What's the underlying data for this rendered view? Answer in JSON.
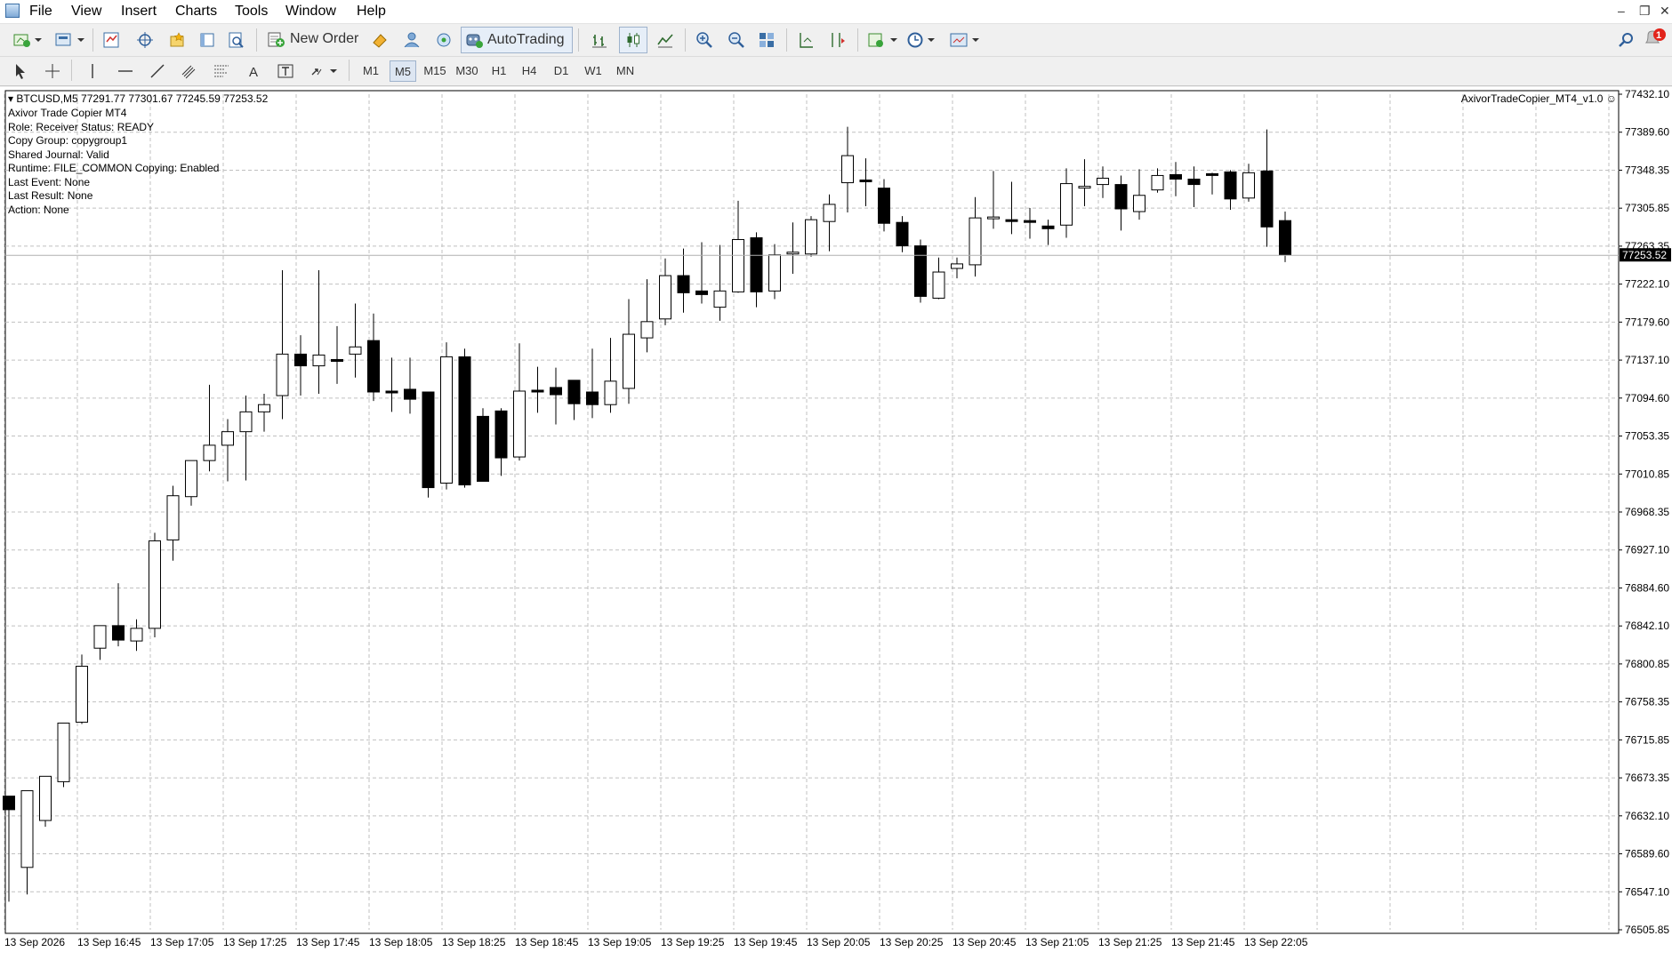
{
  "menu": [
    "File",
    "View",
    "Insert",
    "Charts",
    "Tools",
    "Window",
    "Help"
  ],
  "toolbar": {
    "new_order_label": "New Order",
    "autotrading_label": "AutoTrading",
    "notification_count": "1"
  },
  "timeframes": [
    "M1",
    "M5",
    "M15",
    "M30",
    "H1",
    "H4",
    "D1",
    "W1",
    "MN"
  ],
  "active_timeframe": "M5",
  "chart": {
    "header": "BTCUSD,M5  77291.77 77301.67 77245.59 77253.52",
    "ea_name": "AxivorTradeCopier_MT4_v1.0",
    "current_price_label": "77253.52",
    "info_lines": [
      "Axivor Trade Copier MT4",
      "Role: Receiver   Status: READY",
      "Copy Group: copygroup1",
      "Shared Journal: Valid",
      "Runtime: FILE_COMMON   Copying: Enabled",
      "Last Event: None",
      "Last Result: None",
      "Action: None"
    ]
  },
  "chart_data": {
    "type": "candlestick",
    "symbol": "BTCUSD",
    "timeframe": "M5",
    "ylim": [
      76505.85,
      77432.1
    ],
    "y_ticks": [
      "77432.10",
      "77389.60",
      "77348.35",
      "77305.85",
      "77263.35",
      "77222.10",
      "77179.60",
      "77137.10",
      "77094.60",
      "77053.35",
      "77010.85",
      "76968.35",
      "76927.10",
      "76884.60",
      "76842.10",
      "76800.85",
      "76758.35",
      "76715.85",
      "76673.35",
      "76632.10",
      "76589.60",
      "76547.10",
      "76505.85"
    ],
    "x_ticks": [
      "13 Sep 2026",
      "13 Sep 16:45",
      "13 Sep 17:05",
      "13 Sep 17:25",
      "13 Sep 17:45",
      "13 Sep 18:05",
      "13 Sep 18:25",
      "13 Sep 18:45",
      "13 Sep 19:05",
      "13 Sep 19:25",
      "13 Sep 19:45",
      "13 Sep 20:05",
      "13 Sep 20:25",
      "13 Sep 20:45",
      "13 Sep 21:05",
      "13 Sep 21:25",
      "13 Sep 21:45",
      "13 Sep 22:05"
    ],
    "current_price": 77253.52,
    "grid": true,
    "candles": [
      [
        76654,
        76639,
        76537,
        76654
      ],
      [
        76575,
        76660,
        76545,
        76575
      ],
      [
        76627,
        76676,
        76620,
        76658
      ],
      [
        76670,
        76735,
        76664,
        76733
      ],
      [
        76736,
        76798,
        76734,
        76811
      ],
      [
        76818,
        76843,
        76805,
        76836
      ],
      [
        76843,
        76827,
        76820,
        76890
      ],
      [
        76826,
        76840,
        76815,
        76850
      ],
      [
        76840,
        76937,
        76830,
        76946
      ],
      [
        76938,
        76987,
        76915,
        76998
      ],
      [
        76986,
        77026,
        76976,
        77026
      ],
      [
        77026,
        77043,
        77014,
        77110
      ],
      [
        77043,
        77058,
        77003,
        77072
      ],
      [
        77058,
        77080,
        77004,
        77098
      ],
      [
        77080,
        77088,
        77058,
        77100
      ],
      [
        77098,
        77144,
        77072,
        77237
      ],
      [
        77144,
        77131,
        77098,
        77165
      ],
      [
        77131,
        77143,
        77100,
        77237
      ],
      [
        77138,
        77136,
        77111,
        77175
      ],
      [
        77144,
        77152,
        77118,
        77200
      ],
      [
        77159,
        77102,
        77092,
        77189
      ],
      [
        77103,
        77101,
        77080,
        77140
      ],
      [
        77105,
        77094,
        77078,
        77140
      ],
      [
        77102,
        76996,
        76985,
        77102
      ],
      [
        77001,
        77141,
        76994,
        77157
      ],
      [
        77141,
        76999,
        76996,
        77150
      ],
      [
        77075,
        77003,
        77009,
        77084
      ],
      [
        77081,
        77029,
        77009,
        77084
      ],
      [
        77030,
        77103,
        77026,
        77156
      ],
      [
        77104,
        77102,
        77079,
        77130
      ],
      [
        77107,
        77099,
        77066,
        77129
      ],
      [
        77115,
        77089,
        77071,
        77115
      ],
      [
        77102,
        77088,
        77073,
        77150
      ],
      [
        77088,
        77114,
        77079,
        77162
      ],
      [
        77106,
        77166,
        77089,
        77205
      ],
      [
        77162,
        77180,
        77146,
        77227
      ],
      [
        77183,
        77231,
        77176,
        77250
      ],
      [
        77231,
        77212,
        77190,
        77261
      ],
      [
        77214,
        77210,
        77200,
        77268
      ],
      [
        77196,
        77214,
        77181,
        77265
      ],
      [
        77213,
        77271,
        77212,
        77314
      ],
      [
        77273,
        77213,
        77196,
        77279
      ],
      [
        77214,
        77254,
        77205,
        77266
      ],
      [
        77256,
        77257,
        77233,
        77290
      ],
      [
        77255,
        77293,
        77252,
        77297
      ],
      [
        77291,
        77310,
        77258,
        77321
      ],
      [
        77334,
        77364,
        77301,
        77396
      ],
      [
        77337,
        77336,
        77308,
        77361
      ],
      [
        77328,
        77289,
        77280,
        77338
      ],
      [
        77290,
        77264,
        77257,
        77297
      ],
      [
        77264,
        77208,
        77201,
        77271
      ],
      [
        77206,
        77235,
        77205,
        77251
      ],
      [
        77239,
        77244,
        77228,
        77251
      ],
      [
        77243,
        77295,
        77230,
        77318
      ],
      [
        77296,
        77296,
        77283,
        77347
      ],
      [
        77293,
        77291,
        77277,
        77335
      ],
      [
        77292,
        77291,
        77272,
        77306
      ],
      [
        77286,
        77283,
        77265,
        77293
      ],
      [
        77287,
        77333,
        77273,
        77350
      ],
      [
        77329,
        77330,
        77308,
        77360
      ],
      [
        77332,
        77339,
        77317,
        77352
      ],
      [
        77332,
        77305,
        77281,
        77342
      ],
      [
        77302,
        77320,
        77293,
        77349
      ],
      [
        77326,
        77342,
        77323,
        77350
      ],
      [
        77343,
        77338,
        77319,
        77357
      ],
      [
        77338,
        77332,
        77307,
        77352
      ],
      [
        77344,
        77343,
        77321,
        77345
      ],
      [
        77346,
        77316,
        77304,
        77348
      ],
      [
        77317,
        77345,
        77313,
        77355
      ],
      [
        77347,
        77285,
        77263,
        77393
      ],
      [
        77292,
        77254,
        77246,
        77302
      ]
    ]
  },
  "colors": {
    "bear": "#000000",
    "bull": "#ffffff",
    "outline": "#000000",
    "grid": "#c0c0c0",
    "price_label_bg": "#000000",
    "price_label_fg": "#ffffff"
  }
}
